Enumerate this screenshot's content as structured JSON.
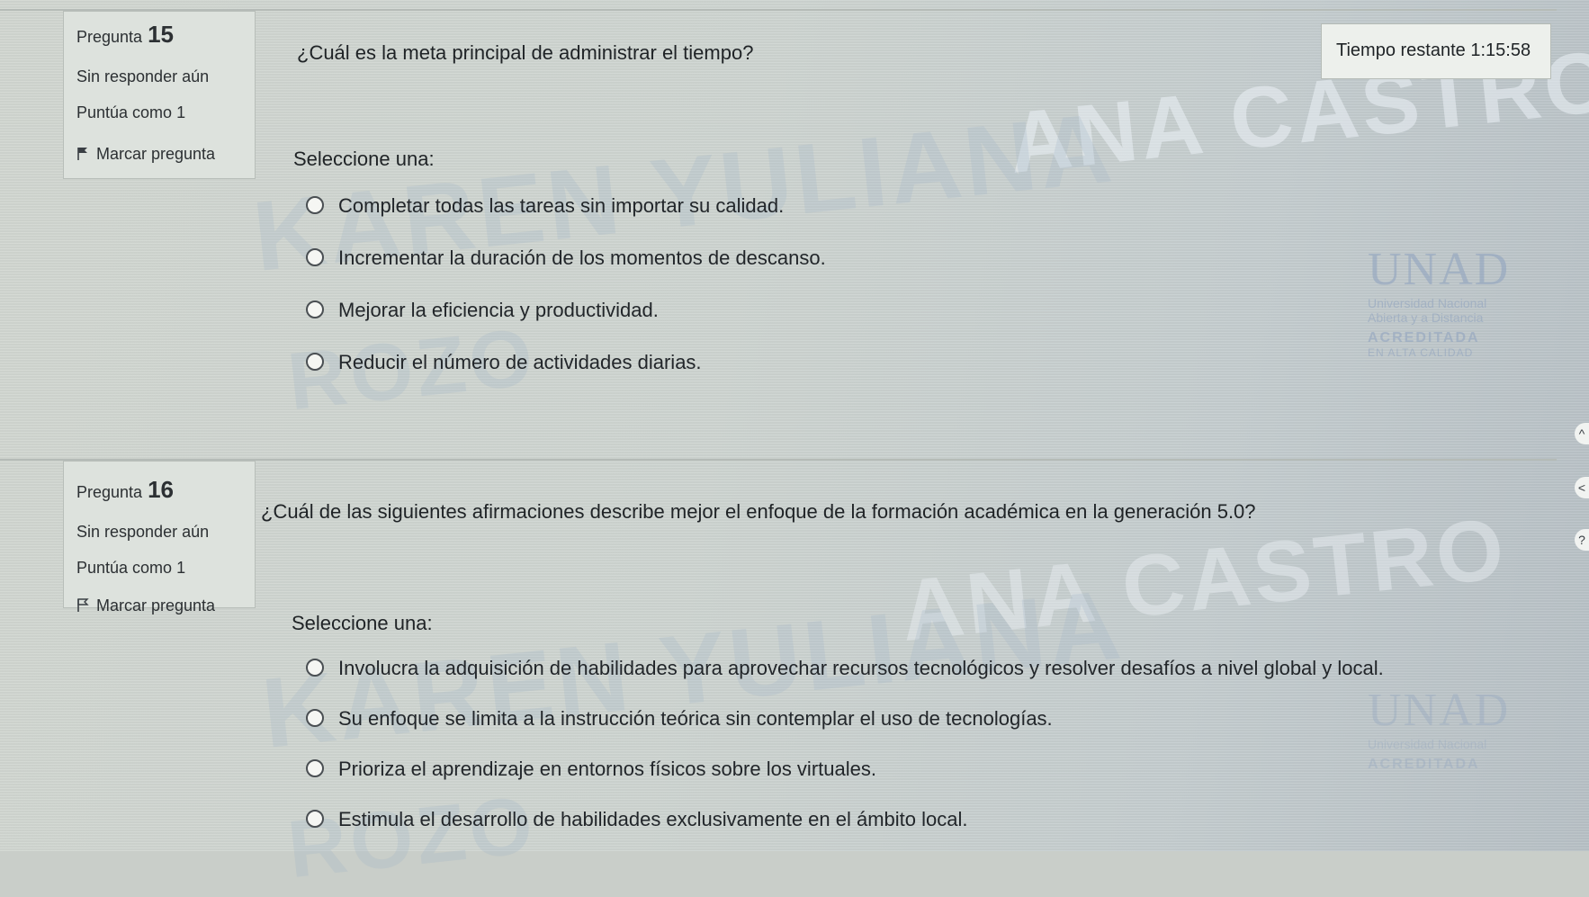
{
  "timer": {
    "label": "Tiempo restante",
    "value": "1:15:58"
  },
  "watermark": {
    "line1": "ANA CASTRO",
    "line2": "KAREN YULIANA",
    "line3": "ROZO"
  },
  "logo": {
    "name": "UNAD",
    "sub1": "Universidad Nacional",
    "sub2": "Abierta y a Distancia",
    "sub3": "ACREDITADA",
    "sub4": "EN ALTA CALIDAD"
  },
  "questions": [
    {
      "label": "Pregunta",
      "number": "15",
      "status": "Sin responder aún",
      "score": "Puntúa como 1",
      "flag_label": "Marcar pregunta",
      "text": "¿Cuál es la meta principal de administrar el tiempo?",
      "select_label": "Seleccione una:",
      "options": [
        "Completar todas las tareas sin importar su calidad.",
        "Incrementar la duración de los momentos de descanso.",
        "Mejorar la eficiencia y productividad.",
        "Reducir el número de actividades diarias."
      ]
    },
    {
      "label": "Pregunta",
      "number": "16",
      "status": "Sin responder aún",
      "score": "Puntúa como 1",
      "flag_label": "Marcar pregunta",
      "text": "¿Cuál de las siguientes afirmaciones describe mejor el enfoque de la formación académica en la generación 5.0?",
      "select_label": "Seleccione una:",
      "options": [
        "Involucra la adquisición de habilidades para aprovechar recursos tecnológicos y resolver desafíos a nivel global y local.",
        "Su enfoque se limita a la instrucción teórica sin contemplar el uso de tecnologías.",
        "Prioriza el aprendizaje en entornos físicos sobre los virtuales.",
        "Estimula el desarrollo de habilidades exclusivamente en el ámbito local."
      ]
    }
  ],
  "side_buttons": {
    "up": "^",
    "left": "<",
    "help": "?"
  }
}
